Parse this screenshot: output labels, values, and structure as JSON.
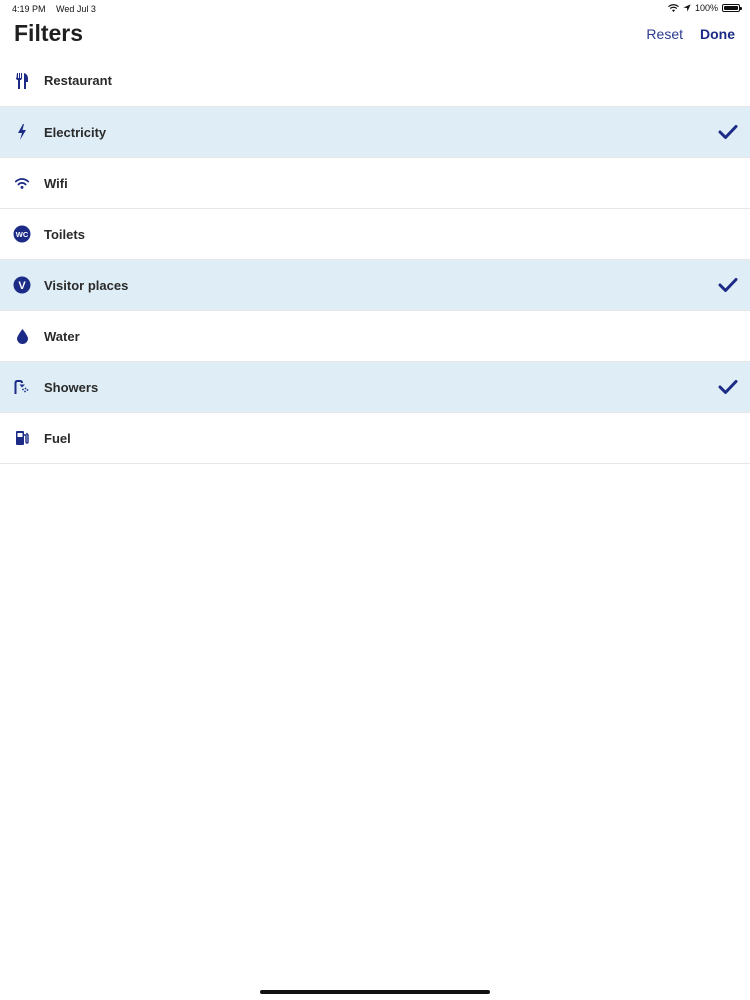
{
  "status_bar": {
    "time": "4:19 PM",
    "date": "Wed Jul 3",
    "battery": "100%"
  },
  "header": {
    "title": "Filters",
    "reset_label": "Reset",
    "done_label": "Done"
  },
  "colors": {
    "accent": "#1c2c86",
    "selected_row": "#dfeef6"
  },
  "filters": [
    {
      "label": "Restaurant",
      "icon": "restaurant-icon",
      "selected": false
    },
    {
      "label": "Electricity",
      "icon": "lightning-icon",
      "selected": true
    },
    {
      "label": "Wifi",
      "icon": "wifi-icon",
      "selected": false
    },
    {
      "label": "Toilets",
      "icon": "wc-icon",
      "selected": false,
      "icon_text": "WC"
    },
    {
      "label": "Visitor places",
      "icon": "visitor-icon",
      "selected": true,
      "icon_text": "V"
    },
    {
      "label": "Water",
      "icon": "water-drop-icon",
      "selected": false
    },
    {
      "label": "Showers",
      "icon": "shower-icon",
      "selected": true
    },
    {
      "label": "Fuel",
      "icon": "fuel-pump-icon",
      "selected": false
    }
  ]
}
